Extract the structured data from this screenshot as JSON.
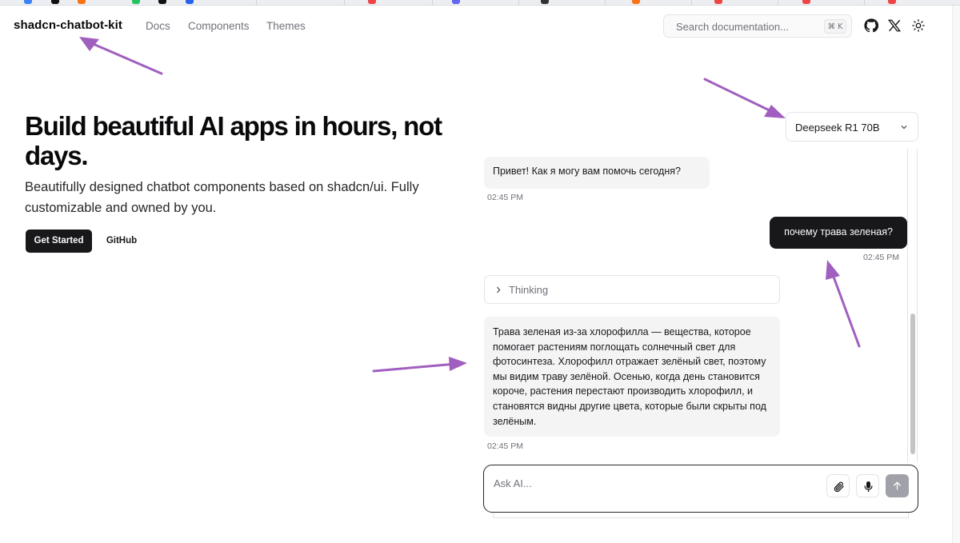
{
  "header": {
    "brand": "shadcn-chatbot-kit",
    "nav": [
      "Docs",
      "Components",
      "Themes"
    ],
    "search_placeholder": "Search documentation...",
    "search_shortcut": "⌘ K",
    "icons": [
      "github-icon",
      "x-icon",
      "sun-icon"
    ]
  },
  "hero": {
    "title": "Build beautiful AI apps in hours, not days.",
    "subtitle": "Beautifully designed chatbot components based on shadcn/ui. Fully customizable and owned by you.",
    "primary_label": "Get Started",
    "secondary_label": "GitHub"
  },
  "chat": {
    "model": "Deepseek R1 70B",
    "messages": [
      {
        "role": "assistant",
        "text": "Привет! Как я могу вам помочь сегодня?",
        "time": "02:45 PM"
      },
      {
        "role": "user",
        "text": "почему трава зеленая?",
        "time": "02:45 PM"
      },
      {
        "role": "assistant",
        "text": "Трава зеленая из-за хлорофилла — вещества, которое помогает растениям поглощать солнечный свет для фотосинтеза. Хлорофилл отражает зелёный свет, поэтому мы видим траву зелёной. Осенью, когда день становится короче, растения перестают производить хлорофилл, и становятся видны другие цвета, которые были скрыты под зелёным.",
        "time": "02:45 PM"
      }
    ],
    "thinking_label": "Thinking",
    "input_placeholder": "Ask AI..."
  },
  "colors": {
    "accent_dark": "#18181b",
    "muted_text": "#71717a",
    "bubble_bg": "#f4f4f5",
    "annotation_arrow": "#a05fbf"
  }
}
